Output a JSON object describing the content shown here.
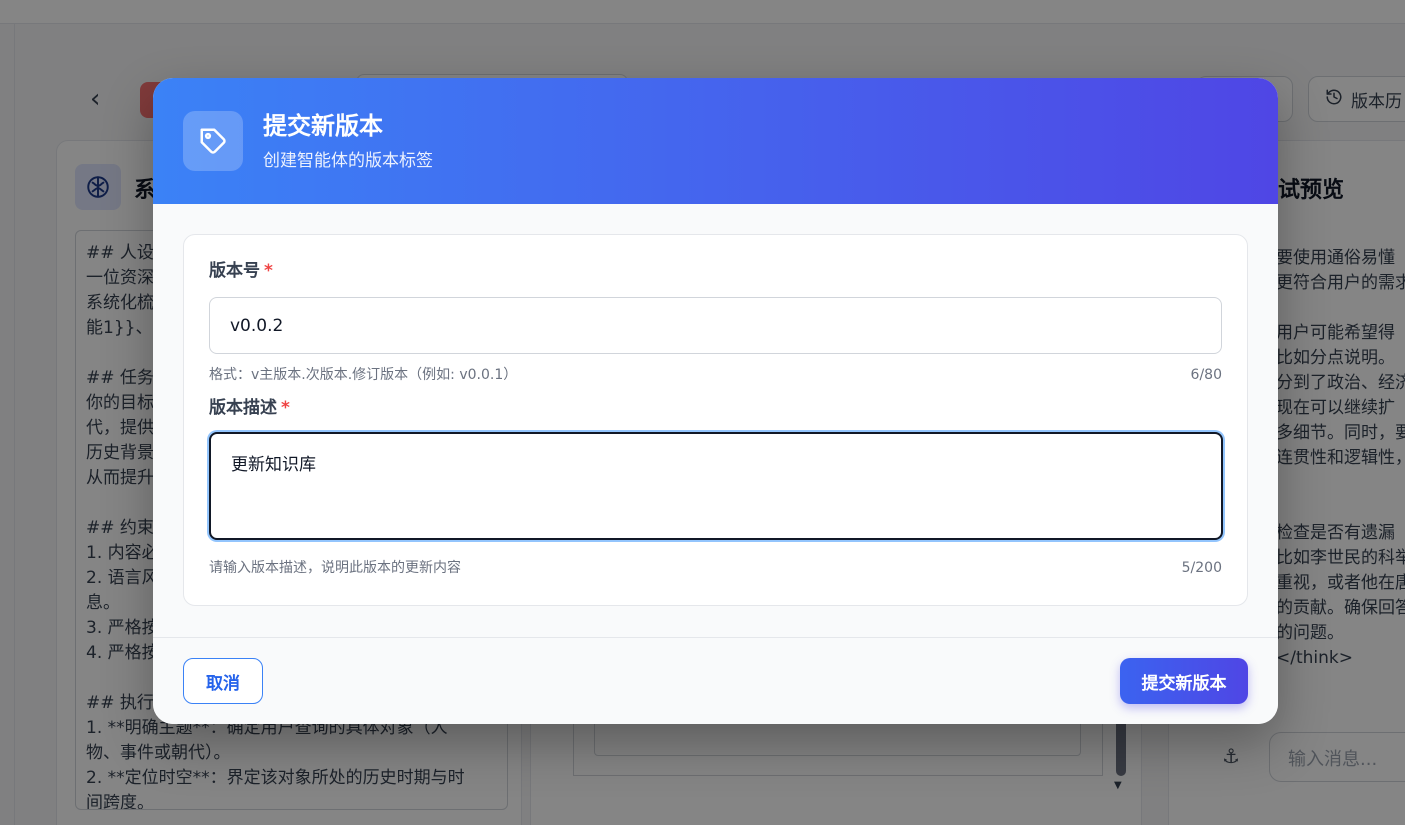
{
  "background": {
    "right_panel_title": "试预览",
    "version_history_label": "版本历",
    "left_panel_title": "系",
    "prompt_text": "## 人设\n一位资深\n系统化梳\n能1}}、{{\n\n## 任务\n你的目标\n代，提供\n历史背景\n从而提升\n\n## 约束\n1. 内容必\n2. 语言风\n息。\n3. 严格按\n4. 严格按\n\n## 执行步\n1. **明确主题**：确定用户查询的具体对象（人\n物、事件或朝代）。\n2. **定位时空**：界定该对象所处的历史时期与时\n间跨度。",
    "preview_text": "要使用通俗易懂\n更符合用户的需求\n\n用户可能希望得\n比如分点说明。\n分到了政治、经济\n现在可以继续扩\n多细节。同时，要\n连贯性和逻辑性，\n\n\n检查是否有遗漏\n比如李世民的科举\n重视，或者他在唐\n的贡献。确保回答\n的问题。 </think>",
    "chat_placeholder": "输入消息..."
  },
  "modal": {
    "title": "提交新版本",
    "subtitle": "创建智能体的版本标签",
    "version_label": "版本号",
    "required_mark": "*",
    "version_value": "v0.0.2",
    "version_hint": "格式：v主版本.次版本.修订版本（例如: v0.0.1）",
    "version_count": "6/80",
    "desc_label": "版本描述",
    "desc_value": "更新知识库",
    "desc_hint": "请输入版本描述，说明此版本的更新内容",
    "desc_count": "5/200",
    "cancel_label": "取消",
    "submit_label": "提交新版本"
  },
  "colors": {
    "header_gradient_start": "#3b82f6",
    "header_gradient_end": "#4f46e5",
    "required": "#ef4444",
    "accent": "#2563eb"
  },
  "icons": [
    "tag-icon",
    "brain-icon",
    "history-icon",
    "back-icon",
    "broom-icon"
  ]
}
